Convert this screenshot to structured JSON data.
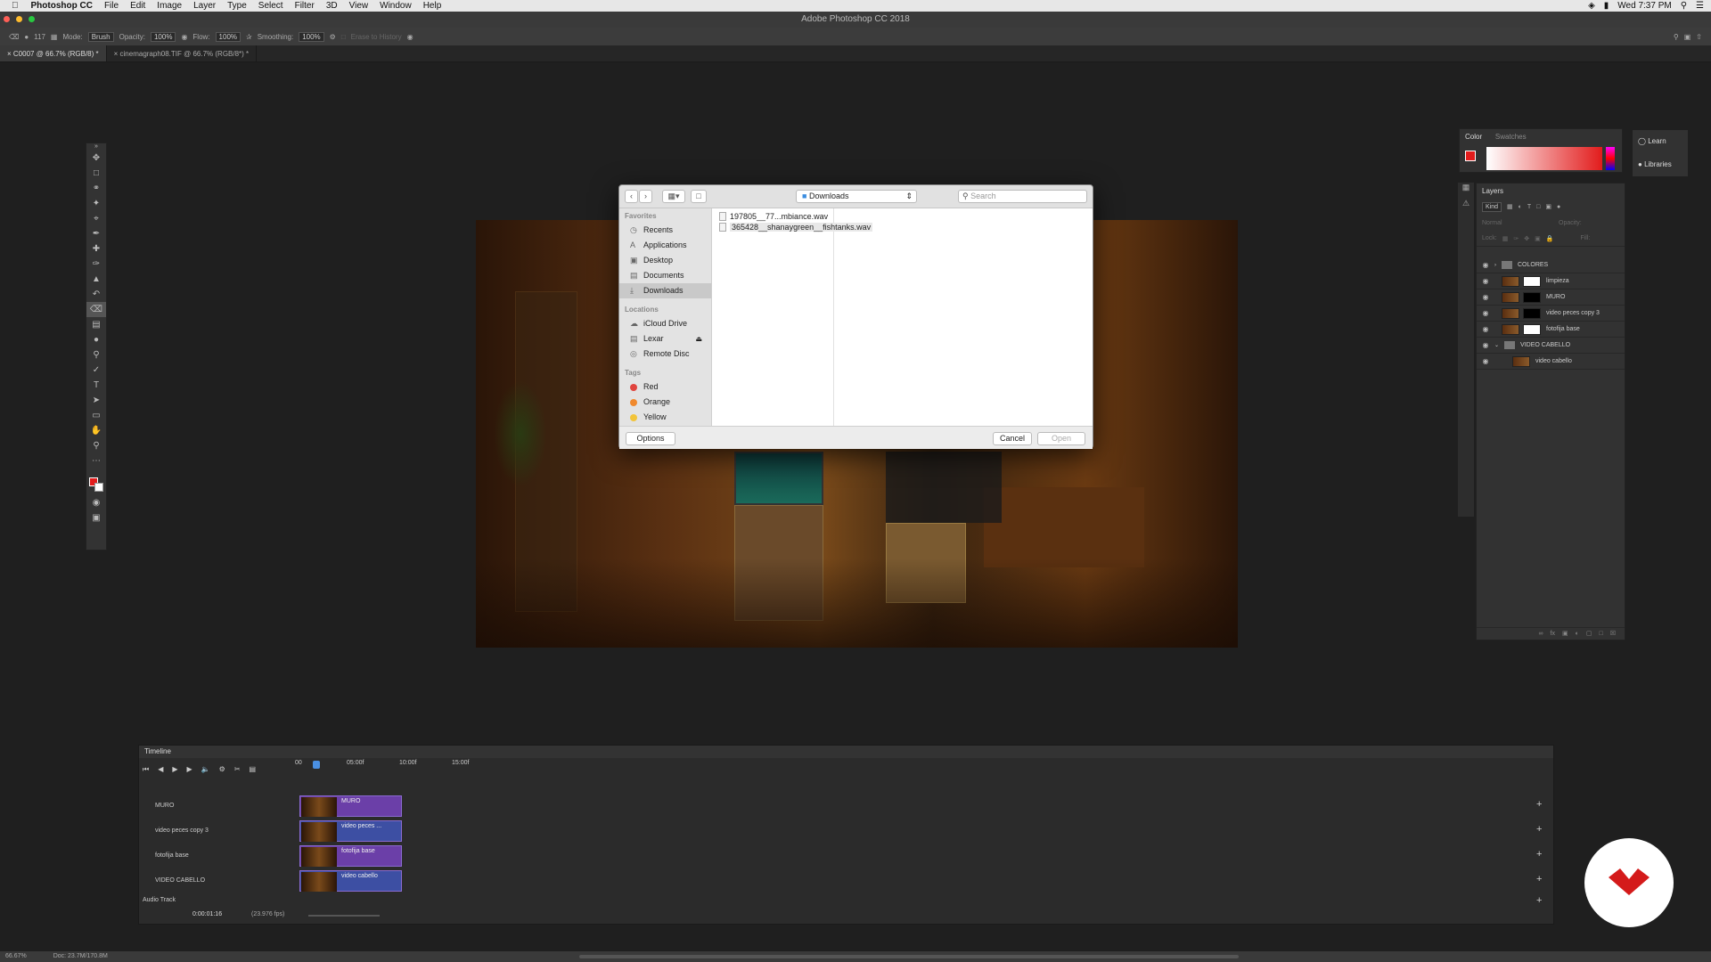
{
  "menubar": {
    "app": "Photoshop CC",
    "items": [
      "File",
      "Edit",
      "Image",
      "Layer",
      "Type",
      "Select",
      "Filter",
      "3D",
      "View",
      "Window",
      "Help"
    ],
    "clock": "Wed 7:37 PM"
  },
  "window": {
    "title": "Adobe Photoshop CC 2018"
  },
  "options": {
    "size": "117",
    "mode_label": "Mode:",
    "mode": "Brush",
    "opacity_label": "Opacity:",
    "opacity": "100%",
    "flow_label": "Flow:",
    "flow": "100%",
    "smoothing_label": "Smoothing:",
    "smoothing": "100%",
    "erase_history": "Erase to History"
  },
  "tabs": [
    {
      "label": "C0007 @ 66.7% (RGB/8) *"
    },
    {
      "label": "cinemagraph08.TIF @ 66.7% (RGB/8*) *"
    }
  ],
  "dialog": {
    "location": "Downloads",
    "search_placeholder": "Search",
    "favorites_header": "Favorites",
    "favorites": [
      "Recents",
      "Applications",
      "Desktop",
      "Documents",
      "Downloads"
    ],
    "locations_header": "Locations",
    "locations": [
      "iCloud Drive",
      "Lexar",
      "Remote Disc"
    ],
    "tags_header": "Tags",
    "tags": [
      {
        "name": "Red",
        "color": "#e0443e"
      },
      {
        "name": "Orange",
        "color": "#f0892d"
      },
      {
        "name": "Yellow",
        "color": "#f2c43a"
      }
    ],
    "files": [
      "197805__77...mbiance.wav",
      "365428__shanaygreen__fishtanks.wav"
    ],
    "options_btn": "Options",
    "cancel_btn": "Cancel",
    "open_btn": "Open"
  },
  "color_panel": {
    "tabs": [
      "Color",
      "Swatches"
    ]
  },
  "learn_panel": {
    "learn": "Learn",
    "libraries": "Libraries"
  },
  "layers": {
    "title": "Layers",
    "kind": "Kind",
    "blend": "Normal",
    "opacity": "Opacity:",
    "lock": "Lock:",
    "fill": "Fill:",
    "items": [
      {
        "name": "COLORES",
        "type": "group"
      },
      {
        "name": "limpieza",
        "type": "layer"
      },
      {
        "name": "MURO",
        "type": "layer"
      },
      {
        "name": "video peces copy 3",
        "type": "layer"
      },
      {
        "name": "fotofija base",
        "type": "layer"
      },
      {
        "name": "VIDEO CABELLO",
        "type": "group"
      },
      {
        "name": "video cabello",
        "type": "video"
      }
    ]
  },
  "timeline": {
    "title": "Timeline",
    "ruler": [
      "00",
      "05:00f",
      "10:00f",
      "15:00f"
    ],
    "tracks": [
      {
        "name": "MURO",
        "clip": "MURO",
        "color": "purple"
      },
      {
        "name": "video peces copy 3",
        "clip": "video peces ...",
        "color": "blue"
      },
      {
        "name": "fotofija base",
        "clip": "fotofija base",
        "color": "purple"
      },
      {
        "name": "VIDEO CABELLO",
        "clip": "video cabello",
        "color": "blue"
      }
    ],
    "audio": "Audio Track",
    "timecode": "0:00:01:16",
    "fps": "(23.976 fps)"
  },
  "status": {
    "zoom": "66.67%",
    "doc": "Doc: 23.7M/170.8M"
  }
}
